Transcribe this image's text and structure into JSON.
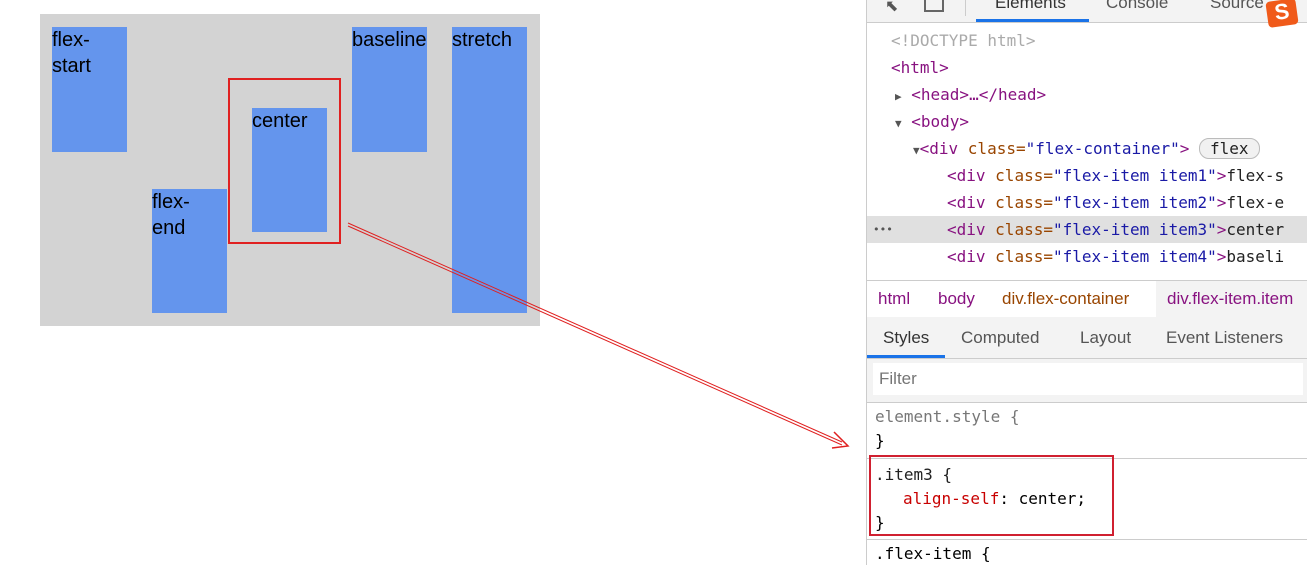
{
  "demo": {
    "items": [
      "flex-\nstart",
      "flex-\nend",
      "center",
      "baseline",
      "stretch"
    ],
    "colors": {
      "container": "#d3d3d3",
      "item": "#6495ed",
      "highlight": "#e02020"
    }
  },
  "devtools": {
    "top_tabs": [
      "Elements",
      "Console",
      "Source"
    ],
    "dom": {
      "doctype": "<!DOCTYPE html>",
      "html": "<html>",
      "head": "<head>…</head>",
      "body": "<body>",
      "container_open": "<div ",
      "container_attr": "class=",
      "container_val": "\"flex-container\"",
      "container_close": ">",
      "flex_badge": "flex",
      "items": [
        {
          "cls": "\"flex-item item1\"",
          "text": "flex-s"
        },
        {
          "cls": "\"flex-item item2\"",
          "text": "flex-e"
        },
        {
          "cls": "\"flex-item item3\"",
          "text": "center"
        },
        {
          "cls": "\"flex-item item4\"",
          "text": "baseli"
        }
      ],
      "div_open": "<div ",
      "attr_class": "class=",
      "gt": ">",
      "ellipsis": "•••"
    },
    "breadcrumbs": [
      "html",
      "body",
      "div.flex-container",
      "div.flex-item.item"
    ],
    "style_tabs": [
      "Styles",
      "Computed",
      "Layout",
      "Event Listeners"
    ],
    "filter_placeholder": "Filter",
    "rules": {
      "element_style": "element.style {",
      "close": "}",
      "item3_selector": ".item3 {",
      "prop": "align-self",
      "colon": ": ",
      "value": "center;",
      "flex_item": ".flex-item {"
    }
  }
}
